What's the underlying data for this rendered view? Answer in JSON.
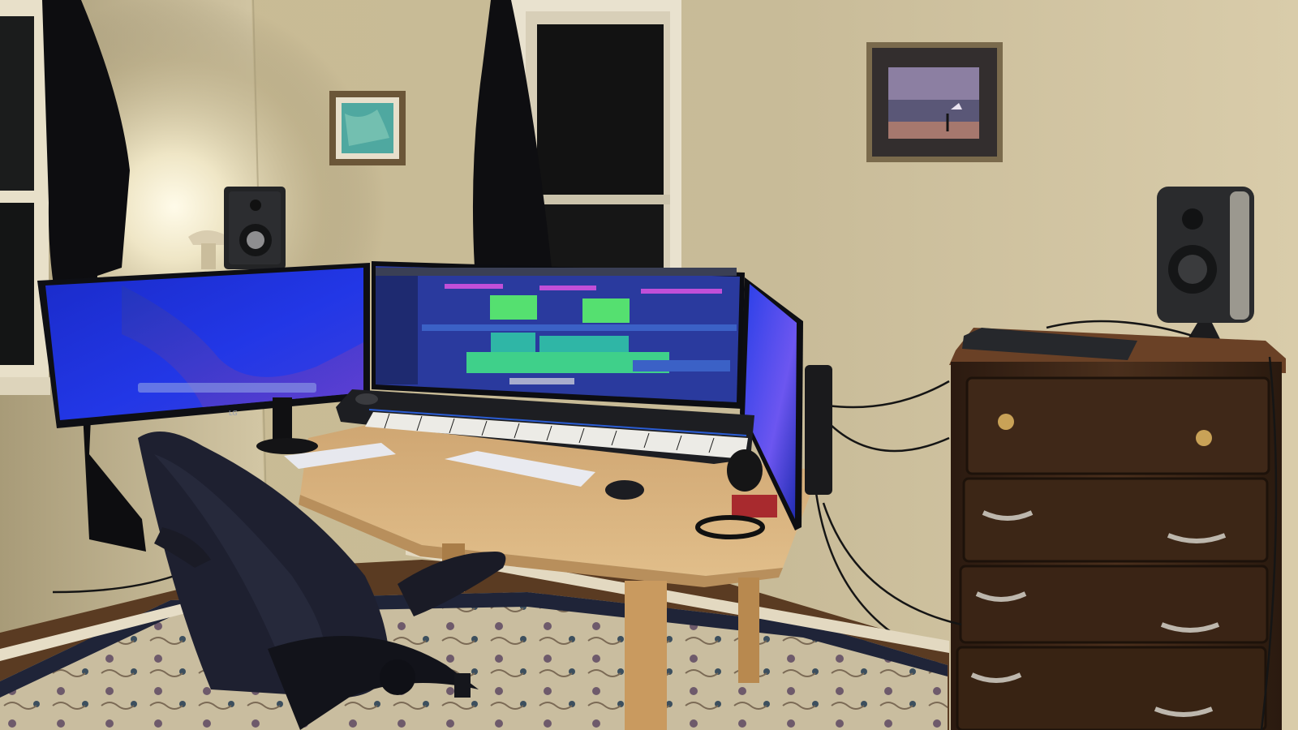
{
  "scene": {
    "description_type": "photo",
    "colors": {
      "wall_warm": "#cdbf98",
      "wall_shadow": "#8f8469",
      "lamp_glow": "#fff6da",
      "screen_blue": "#1f2fd6",
      "daw_teal": "#2fb6a6",
      "daw_green": "#55e070",
      "desk_wood": "#d8b27c",
      "dresser_wood": "#3b2516",
      "rug_cream": "#cbbfa2",
      "rug_navy": "#1f2438"
    }
  },
  "monitor_left": {
    "logo_text": "LG"
  }
}
